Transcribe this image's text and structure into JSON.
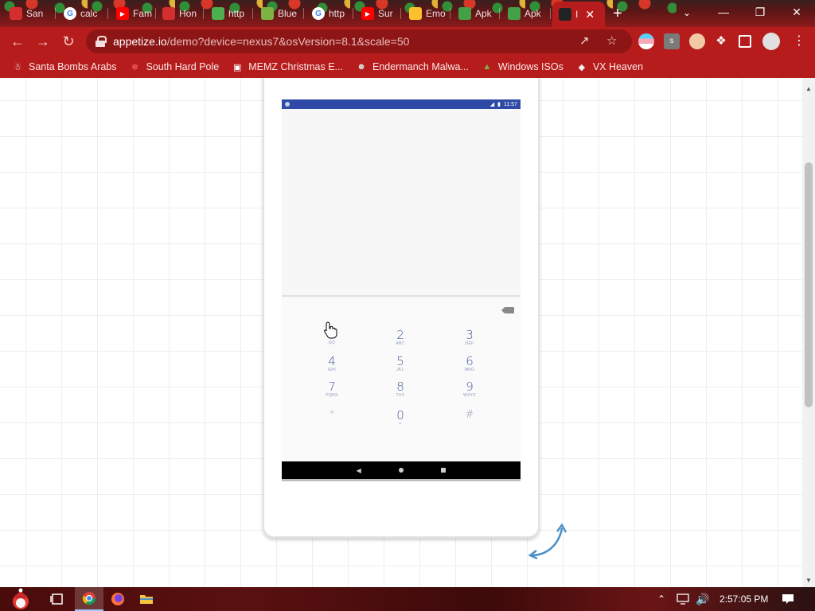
{
  "tabs": [
    {
      "label": "San",
      "favicon": "santa-icon",
      "color": "#d32f2f"
    },
    {
      "label": "calc",
      "favicon": "google-icon",
      "color": "#ffffff"
    },
    {
      "label": "Fam",
      "favicon": "youtube-icon",
      "color": "#ff0000"
    },
    {
      "label": "Hon",
      "favicon": "star-icon",
      "color": "#d32f2f"
    },
    {
      "label": "http",
      "favicon": "drive-icon",
      "color": "#4caf50"
    },
    {
      "label": "Blue",
      "favicon": "bluestacks-icon",
      "color": "#7cb342"
    },
    {
      "label": "http",
      "favicon": "google-icon",
      "color": "#ffffff"
    },
    {
      "label": "Sur",
      "favicon": "youtube-icon",
      "color": "#ff0000"
    },
    {
      "label": "Emo",
      "favicon": "emoji-icon",
      "color": "#fbc02d"
    },
    {
      "label": "Apk",
      "favicon": "apk-icon",
      "color": "#43a047"
    },
    {
      "label": "Apk",
      "favicon": "apk-icon",
      "color": "#43a047"
    },
    {
      "label": "I",
      "favicon": "appetize-icon",
      "color": "#222222",
      "active": true
    }
  ],
  "toolbar": {
    "url_host": "appetize.io",
    "url_path": "/demo?device=nexus7&osVersion=8.1&scale=50"
  },
  "bookmarks": [
    {
      "label": "Santa Bombs Arabs",
      "icon": "santa-figure-icon"
    },
    {
      "label": "South Hard Pole",
      "icon": "snowflake-icon"
    },
    {
      "label": "MEMZ Christmas E...",
      "icon": "image-icon"
    },
    {
      "label": "Endermanch Malwa...",
      "icon": "raccoon-icon"
    },
    {
      "label": "Windows ISOs",
      "icon": "tree-icon"
    },
    {
      "label": "VX Heaven",
      "icon": "vx-icon"
    }
  ],
  "device": {
    "status_time": "11:57",
    "keys": [
      {
        "num": "1",
        "letters": "QO",
        "hidden": true
      },
      {
        "num": "2",
        "letters": "ABC"
      },
      {
        "num": "3",
        "letters": "DEF"
      },
      {
        "num": "4",
        "letters": "GHI"
      },
      {
        "num": "5",
        "letters": "JKL"
      },
      {
        "num": "6",
        "letters": "MNO"
      },
      {
        "num": "7",
        "letters": "PQRS"
      },
      {
        "num": "8",
        "letters": "TUV"
      },
      {
        "num": "9",
        "letters": "WXYZ"
      },
      {
        "num": "*",
        "letters": ""
      },
      {
        "num": "0",
        "letters": "+"
      },
      {
        "num": "#",
        "letters": ""
      }
    ]
  },
  "taskbar": {
    "clock": "2:57:05 PM"
  },
  "colors": {
    "chrome_theme": "#b71c1c",
    "status_bar": "#2f4aa6",
    "dial_digits": "#3f5b96"
  }
}
